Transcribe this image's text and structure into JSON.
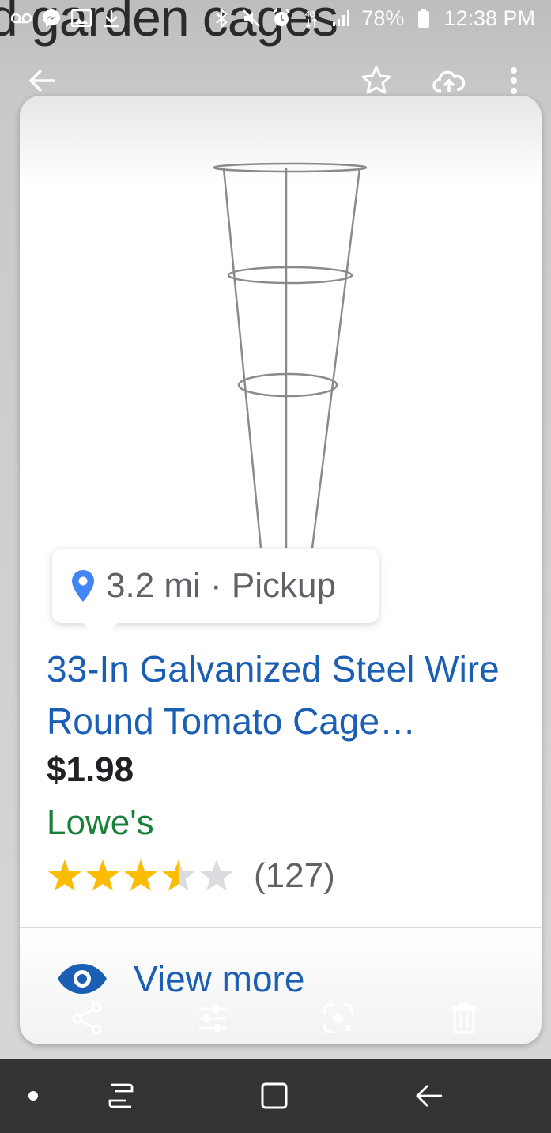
{
  "background": {
    "search_text": "d garden cages"
  },
  "status_bar": {
    "battery": "78%",
    "time": "12:38 PM",
    "icons": [
      "voicemail-icon",
      "messenger-icon",
      "image-icon",
      "download-icon",
      "bluetooth-icon",
      "mute-icon",
      "alarm-icon",
      "4g-icon",
      "signal-icon",
      "battery-icon"
    ]
  },
  "toolbar": {
    "icons": [
      "back-arrow-icon",
      "star-icon",
      "cloud-upload-icon",
      "more-vert-icon"
    ]
  },
  "card": {
    "pickup": "3.2 mi · Pickup",
    "title": "33-In Galvanized Steel Wire Round Tomato Cage…",
    "price": "$1.98",
    "seller": "Lowe's",
    "rating": 3.5,
    "rating_max": 5,
    "review_count": "(127)",
    "view_more": "View more"
  },
  "bottom_actions": {
    "icons": [
      "share-icon",
      "adjust-icon",
      "lens-icon",
      "delete-icon"
    ]
  },
  "nav_bar": {
    "icons": [
      "dot-icon",
      "recents-icon",
      "home-icon",
      "back-icon"
    ]
  },
  "colors": {
    "link_blue": "#1a5fb4",
    "seller_green": "#188038",
    "star_gold": "#fbbc04",
    "star_empty": "#dadce0",
    "pin_blue": "#4285f4"
  }
}
